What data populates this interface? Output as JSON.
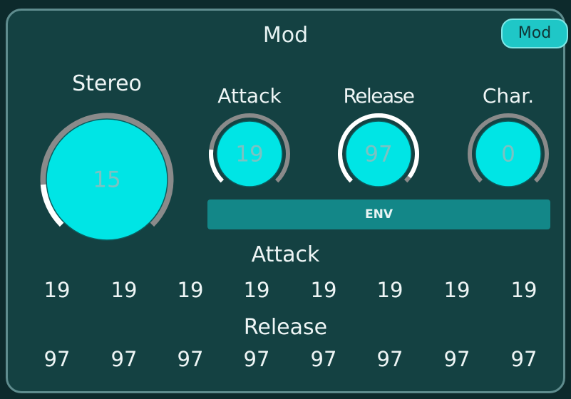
{
  "panel": {
    "title": "Mod",
    "mod_button_label": "Mod",
    "env_label": "ENV"
  },
  "knobs": [
    {
      "label": "Stereo",
      "value": "15",
      "level": 0.15
    },
    {
      "label": "Attack",
      "value": "19",
      "level": 0.19
    },
    {
      "label": "Release",
      "value": "97",
      "level": 0.97
    },
    {
      "label": "Char.",
      "value": "0",
      "level": 0
    }
  ],
  "attack_row": {
    "title": "Attack",
    "values": [
      "19",
      "19",
      "19",
      "19",
      "19",
      "19",
      "19",
      "19"
    ]
  },
  "release_row": {
    "title": "Release",
    "values": [
      "97",
      "97",
      "97",
      "97",
      "97",
      "97",
      "97",
      "97"
    ]
  },
  "colors": {
    "panel_bg": "#144142",
    "knob_fill": "#00e5e5",
    "knob_track": "#8a8a8a",
    "knob_arc": "#ffffff",
    "env_bar": "#138788",
    "mod_button": "#1fc7c7"
  }
}
